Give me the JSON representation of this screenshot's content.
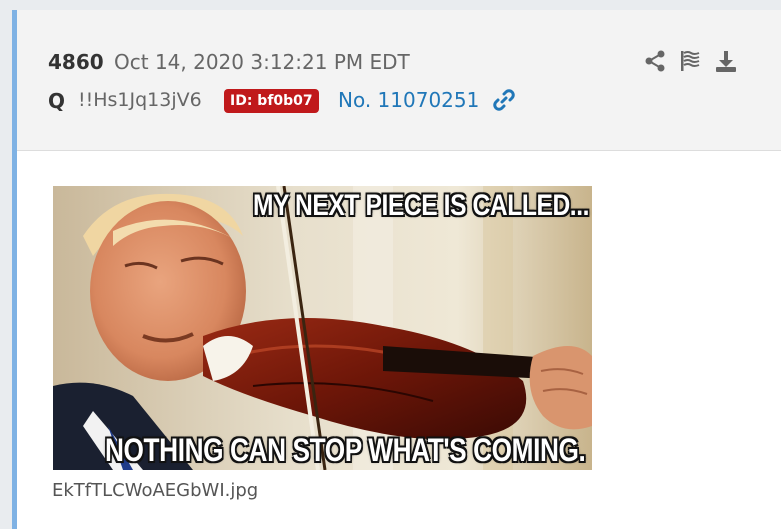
{
  "post": {
    "number": "4860",
    "date": "Oct 14, 2020 3:12:21 PM EDT",
    "author": "Q",
    "tripcode": "!!Hs1Jq13jV6",
    "id_badge": "ID: bf0b07",
    "post_link": "No. 11070251"
  },
  "icons": {
    "share": "share-icon",
    "flag": "flag-icon",
    "download": "download-icon",
    "link": "link-icon"
  },
  "image": {
    "top_caption": "MY NEXT PIECE IS CALLED...",
    "bottom_caption": "NOTHING CAN STOP WHAT'S COMING.",
    "filename": "EkTfTLCWoAEGbWI.jpg"
  },
  "colors": {
    "accent_border": "#7fb2e4",
    "id_badge_bg": "#c0191b",
    "link": "#2077b8"
  }
}
